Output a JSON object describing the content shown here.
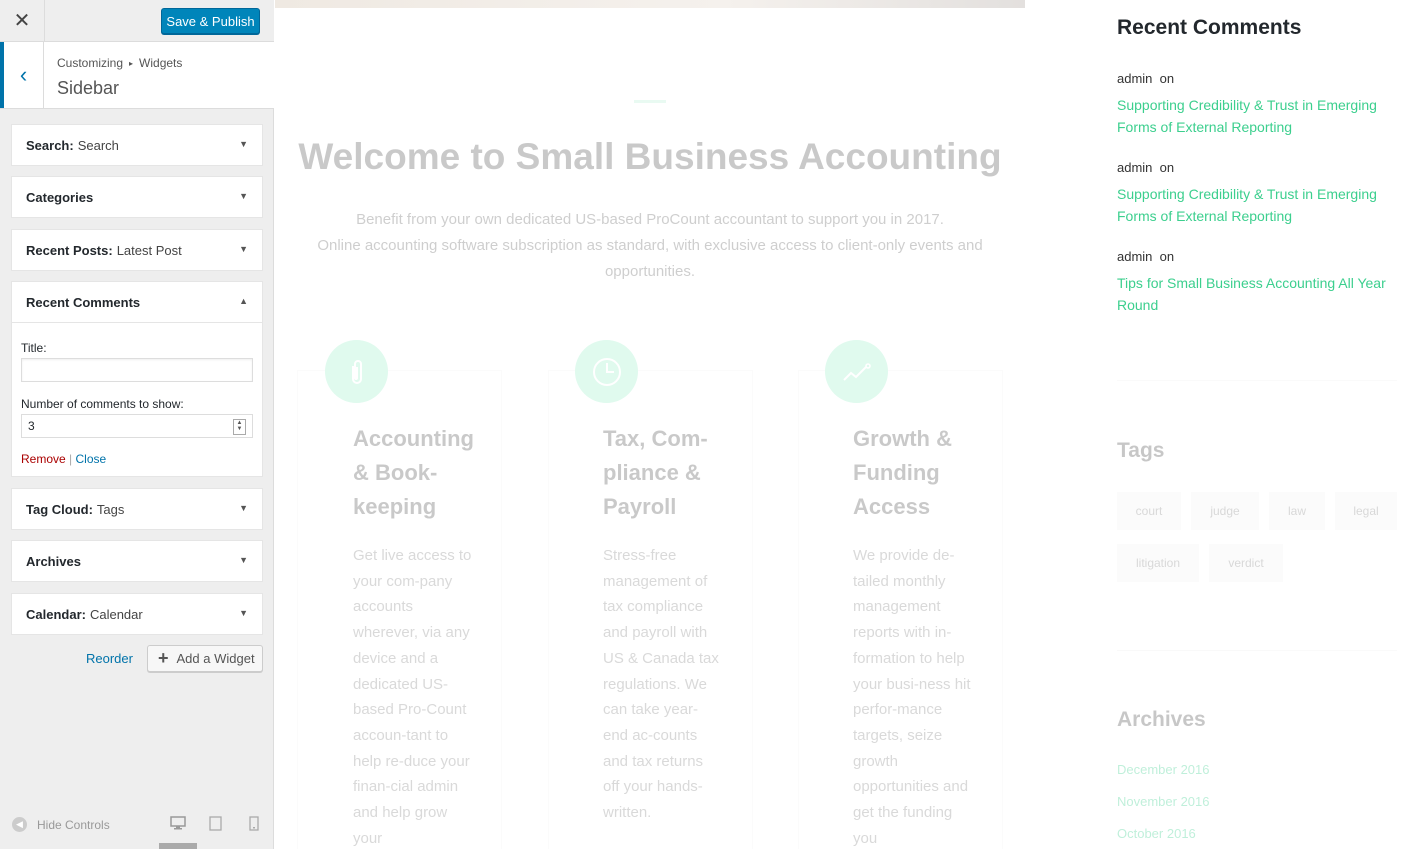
{
  "customizer": {
    "close_icon": "close-icon",
    "publish_label": "Save & Publish",
    "breadcrumb": [
      "Customizing",
      "Widgets"
    ],
    "section_title": "Sidebar",
    "widgets": [
      {
        "title": "Search:",
        "subtitle": "Search"
      },
      {
        "title": "Categories",
        "subtitle": ""
      },
      {
        "title": "Recent Posts:",
        "subtitle": "Latest Post"
      },
      {
        "title": "Recent Comments",
        "subtitle": "",
        "expanded": true,
        "fields": {
          "title_label": "Title:",
          "title_value": "",
          "count_label": "Number of comments to show:",
          "count_value": "3"
        },
        "remove_label": "Remove",
        "close_label": "Close"
      },
      {
        "title": "Tag Cloud:",
        "subtitle": "Tags"
      },
      {
        "title": "Archives",
        "subtitle": ""
      },
      {
        "title": "Calendar:",
        "subtitle": "Calendar"
      }
    ],
    "reorder_label": "Reorder",
    "add_widget_label": "Add a Widget",
    "hide_controls_label": "Hide Controls",
    "active_color": "#0073aa",
    "publish_color": "#0085ba"
  },
  "preview": {
    "welcome_title": "Welcome to Small Business Accounting",
    "intro_line1": "Benefit from your own dedicated US-based ProCount accountant to support you in 2017.",
    "intro_line2": "Online accounting software subscription as standard, with exclusive access to client-only events and opportunities.",
    "cards": [
      {
        "icon": "paperclip-icon",
        "title": "Accounting & Book-keeping",
        "text": "Get live access to your com-pany accounts wherever, via any device and a dedicated US-based Pro-Count accoun-tant to help re-duce your finan-cial admin and help grow your"
      },
      {
        "icon": "clock-icon",
        "title": "Tax, Com-pliance & Payroll",
        "text": "Stress-free management of tax compliance and payroll with US & Canada tax regulations. We can take year-end ac-counts and tax returns off your hands-written."
      },
      {
        "icon": "trend-icon",
        "title": "Growth & Funding Access",
        "text": "We provide de-tailed monthly management reports with in-formation to help your busi-ness hit perfor-mance targets, seize growth opportunities and get the funding you"
      }
    ],
    "recent_comments": {
      "title": "Recent Comments",
      "items": [
        {
          "author": "admin",
          "on": "on",
          "post": "Supporting Credibility & Trust in Emerging Forms of External Reporting"
        },
        {
          "author": "admin",
          "on": "on",
          "post": "Supporting Credibility & Trust in Emerging Forms of External Reporting"
        },
        {
          "author": "admin",
          "on": "on",
          "post": "Tips for Small Business Accounting All Year Round"
        }
      ]
    },
    "tags": {
      "title": "Tags",
      "items": [
        "court",
        "judge",
        "law",
        "legal",
        "litigation",
        "verdict"
      ]
    },
    "archives": {
      "title": "Archives",
      "items": [
        "December 2016",
        "November 2016",
        "October 2016"
      ]
    },
    "accent_color": "#3ccf8e"
  }
}
